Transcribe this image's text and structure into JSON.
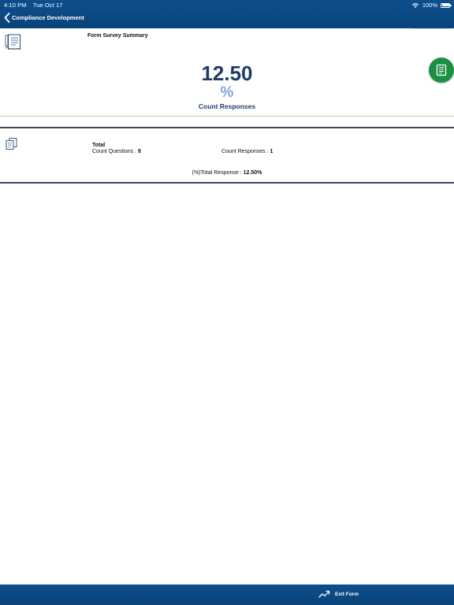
{
  "status_bar": {
    "time": "4:10 PM",
    "date": "Tue Oct 17",
    "battery": "100%"
  },
  "nav": {
    "back_title": "Compliance Development"
  },
  "summary": {
    "title": "Form Survey Summary",
    "value": "12.50",
    "value_unit": "%",
    "value_label": "Count Responses"
  },
  "total": {
    "label": "Total",
    "count_questions_label": "Count Questions : ",
    "count_questions_value": "8",
    "count_responses_label": "Count Responses : ",
    "count_responses_value": "1",
    "total_response_label": "(%)Total Response : ",
    "total_response_value": "12.50%"
  },
  "footer": {
    "exit_label": "Exit Form"
  },
  "icons": {
    "summary": "receipt-icon",
    "total": "documents-icon",
    "fab": "report-icon",
    "back": "chevron-left-icon",
    "exit": "trend-up-icon",
    "wifi": "wifi-icon",
    "battery": "battery-icon"
  },
  "colors": {
    "header": "#0c4f8d",
    "value": "#1f3b66",
    "percent": "#7ea6dd",
    "fab": "#1d8f45"
  }
}
